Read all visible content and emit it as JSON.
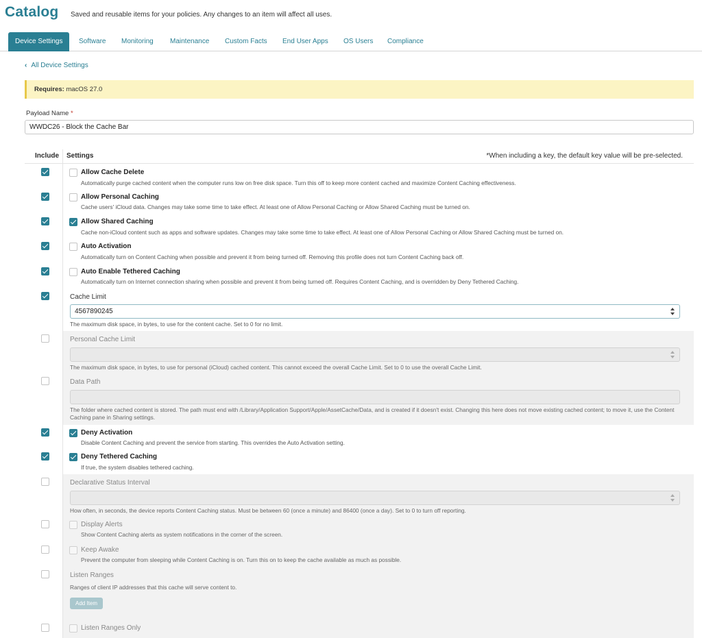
{
  "header": {
    "title": "Catalog",
    "subtitle": "Saved and reusable items for your policies. Any changes to an item will affect all uses."
  },
  "tabs": [
    {
      "label": "Device Settings"
    },
    {
      "label": "Software"
    },
    {
      "label": "Monitoring"
    },
    {
      "label": "Maintenance"
    },
    {
      "label": "Custom Facts"
    },
    {
      "label": "End User Apps"
    },
    {
      "label": "OS Users"
    },
    {
      "label": "Compliance"
    }
  ],
  "back_link": "All Device Settings",
  "requires": {
    "label": "Requires:",
    "value": "macOS 27.0"
  },
  "payload": {
    "label": "Payload Name",
    "required_mark": "*",
    "value": "WWDC26 - Block the Cache Bar"
  },
  "table": {
    "include_header": "Include",
    "settings_header": "Settings",
    "note": "*When including a key, the default key value will be pre-selected."
  },
  "settings": [
    {
      "label": "Allow Cache Delete",
      "included": true,
      "checked": false,
      "description": "Automatically purge cached content when the computer runs low on free disk space. Turn this off to keep more content cached and maximize Content Caching effectiveness."
    },
    {
      "label": "Allow Personal Caching",
      "included": true,
      "checked": false,
      "description": "Cache users' iCloud data. Changes may take some time to take effect. At least one of Allow Personal Caching or Allow Shared Caching must be turned on."
    },
    {
      "label": "Allow Shared Caching",
      "included": true,
      "checked": true,
      "description": "Cache non-iCloud content such as apps and software updates. Changes may take some time to take effect. At least one of Allow Personal Caching or Allow Shared Caching must be turned on."
    },
    {
      "label": "Auto Activation",
      "included": true,
      "checked": false,
      "description": "Automatically turn on Content Caching when possible and prevent it from being turned off. Removing this profile does not turn Content Caching back off."
    },
    {
      "label": "Auto Enable Tethered Caching",
      "included": true,
      "checked": false,
      "description": "Automatically turn on Internet connection sharing when possible and prevent it from being turned off. Requires Content Caching, and is overridden by Deny Tethered Caching."
    },
    {
      "label": "Cache Limit",
      "included": true,
      "value": "4567890245",
      "description": "The maximum disk space, in bytes, to use for the content cache. Set to 0 for no limit."
    },
    {
      "label": "Personal Cache Limit",
      "included": false,
      "value": "",
      "description": "The maximum disk space, in bytes, to use for personal (iCloud) cached content. This cannot exceed the overall Cache Limit. Set to 0 to use the overall Cache Limit."
    },
    {
      "label": "Data Path",
      "included": false,
      "value": "",
      "description": "The folder where cached content is stored. The path must end with /Library/Application Support/Apple/AssetCache/Data, and is created if it doesn't exist. Changing this here does not move existing cached content; to move it, use the Content Caching pane in Sharing settings."
    },
    {
      "label": "Deny Activation",
      "included": true,
      "checked": true,
      "description": "Disable Content Caching and prevent the service from starting. This overrides the Auto Activation setting."
    },
    {
      "label": "Deny Tethered Caching",
      "included": true,
      "checked": true,
      "description": "If true, the system disables tethered caching."
    },
    {
      "label": "Declarative Status Interval",
      "included": false,
      "value": "",
      "description": "How often, in seconds, the device reports Content Caching status. Must be between 60 (once a minute) and 86400 (once a day). Set to 0 to turn off reporting."
    },
    {
      "label": "Display Alerts",
      "included": false,
      "checked": false,
      "description": "Show Content Caching alerts as system notifications in the corner of the screen."
    },
    {
      "label": "Keep Awake",
      "included": false,
      "checked": false,
      "description": "Prevent the computer from sleeping while Content Caching is on. Turn this on to keep the cache available as much as possible."
    },
    {
      "label": "Listen Ranges",
      "included": false,
      "description": "Ranges of client IP addresses that this cache will serve content to.",
      "button": "Add Item"
    },
    {
      "label": "Listen Ranges Only",
      "included": false,
      "checked": false
    }
  ],
  "colors": {
    "accent": "#2a7f93",
    "requires_bg": "#fcf4c4",
    "disabled_bg": "#f2f2f2"
  }
}
